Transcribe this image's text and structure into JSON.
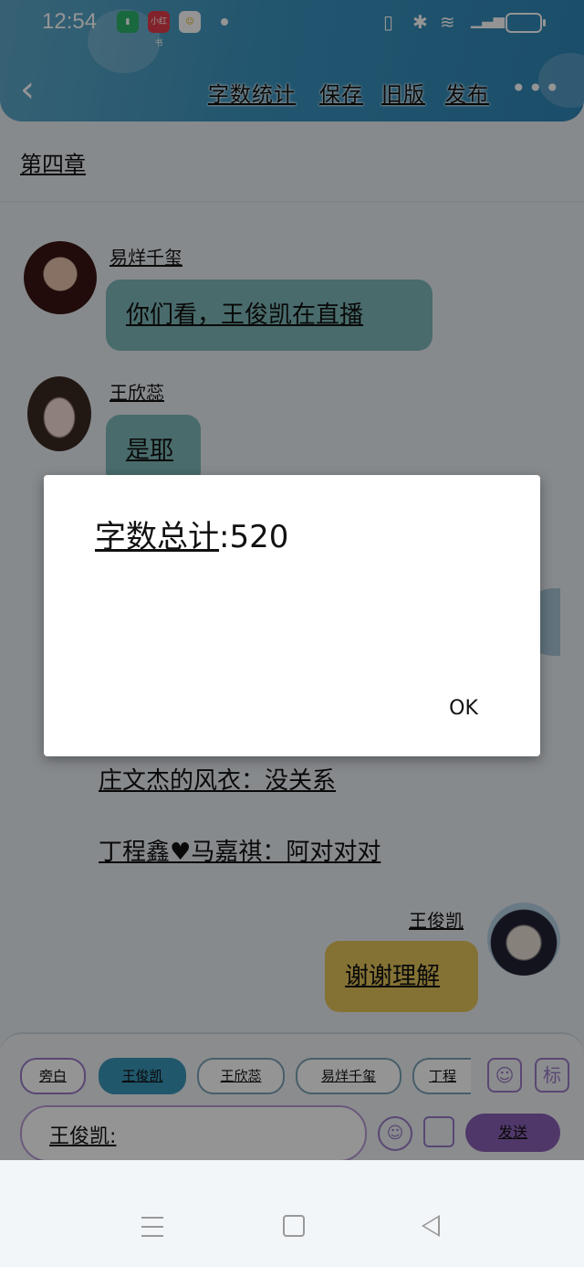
{
  "status_bar": {
    "time": "12:54",
    "app_icon_2_label": "小红书"
  },
  "header": {
    "back_icon": "chevron-left-icon",
    "actions": [
      "字数统计",
      "保存",
      "旧版",
      "发布"
    ],
    "more_icon": "more-dots-icon"
  },
  "chapter_title": "第四章",
  "messages": {
    "m1_sender": "易烊千玺",
    "m1_text": "你们看，王俊凯在直播",
    "m2_sender": "王欣蕊",
    "m2_text": "是耶",
    "plain_1": "庄文杰的风衣：没关系",
    "plain_2": "丁程鑫",
    "plain_2_heart": "♥",
    "plain_2_rest": "马嘉祺：阿对对对",
    "m3_sender": "王俊凯",
    "m3_text": "谢谢理解"
  },
  "composer": {
    "chips": [
      "旁白",
      "王俊凯",
      "王欣蕊",
      "易烊千玺",
      "丁程"
    ],
    "input_value": "王俊凯:",
    "send_label": "发送",
    "tag_label": "标"
  },
  "dialog": {
    "label": "字数总计",
    "value": ":520",
    "ok_label": "OK"
  },
  "colors": {
    "header": "#3b94bf",
    "bubble_teal": "#7fb8b8",
    "bubble_gold": "#e4c45c",
    "send": "#8a5fb5"
  }
}
